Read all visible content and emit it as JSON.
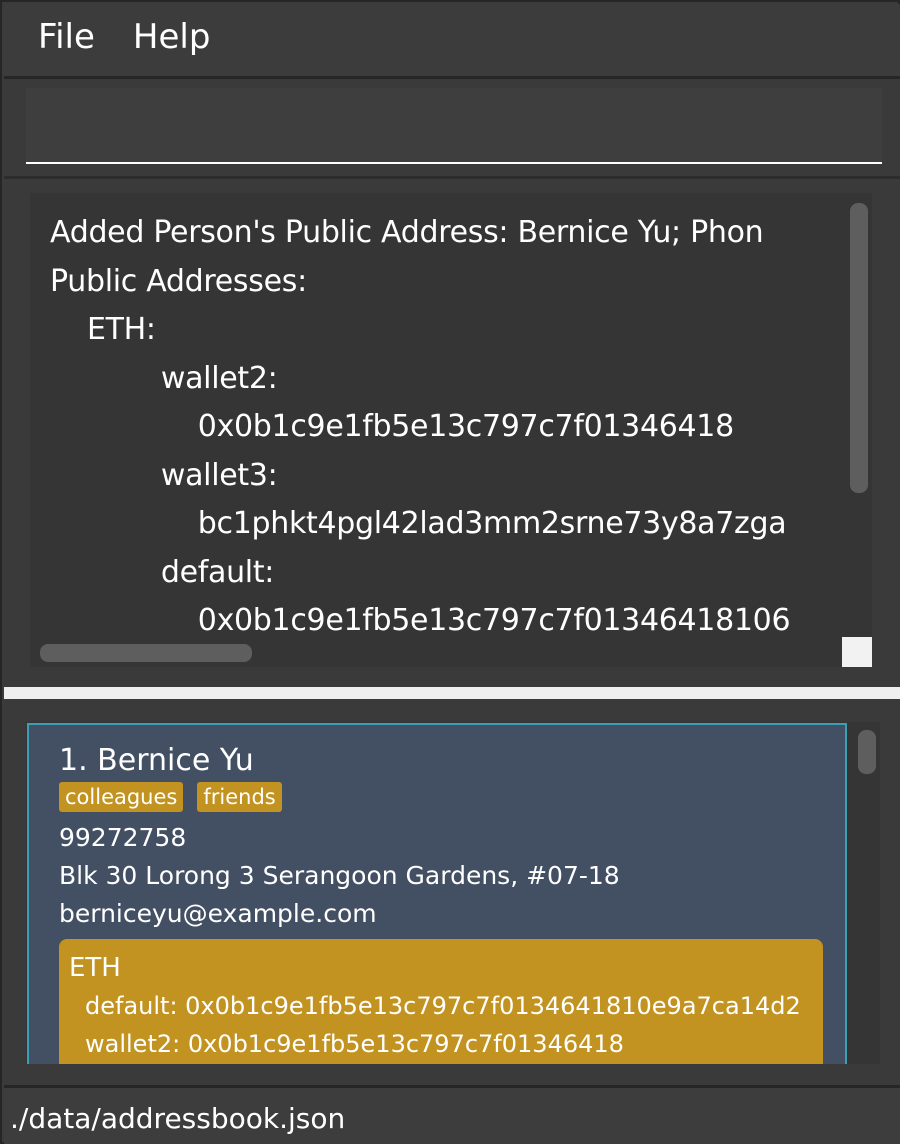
{
  "menu": {
    "file_label": "File",
    "help_label": "Help"
  },
  "command_box": {
    "value": "",
    "placeholder": ""
  },
  "result_display": {
    "text": "Added Person's Public Address: Bernice Yu; Phon\nPublic Addresses:\n    ETH:\n            wallet2:\n                0x0b1c9e1fb5e13c797c7f01346418\n            wallet3:\n                bc1phkt4pgl42lad3mm2srne73y8a7zga\n            default:\n                0x0b1c9e1fb5e13c797c7f01346418106"
  },
  "person_list": {
    "cards": [
      {
        "index_name": "1. Bernice Yu",
        "tags": [
          "colleagues",
          "friends"
        ],
        "phone": "99272758",
        "address": "Blk 30 Lorong 3 Serangoon Gardens, #07-18",
        "email": "berniceyu@example.com",
        "wallets": {
          "currency": "ETH",
          "lines": [
            "default: 0x0b1c9e1fb5e13c797c7f0134641810e9a7ca14d2",
            "wallet2: 0x0b1c9e1fb5e13c797c7f01346418"
          ]
        }
      }
    ]
  },
  "status_bar": {
    "path": "./data/addressbook.json"
  },
  "colors": {
    "background": "#3a3a3a",
    "card_background": "#435064",
    "card_border": "#3ca0b5",
    "tag_gold": "#c29320"
  }
}
